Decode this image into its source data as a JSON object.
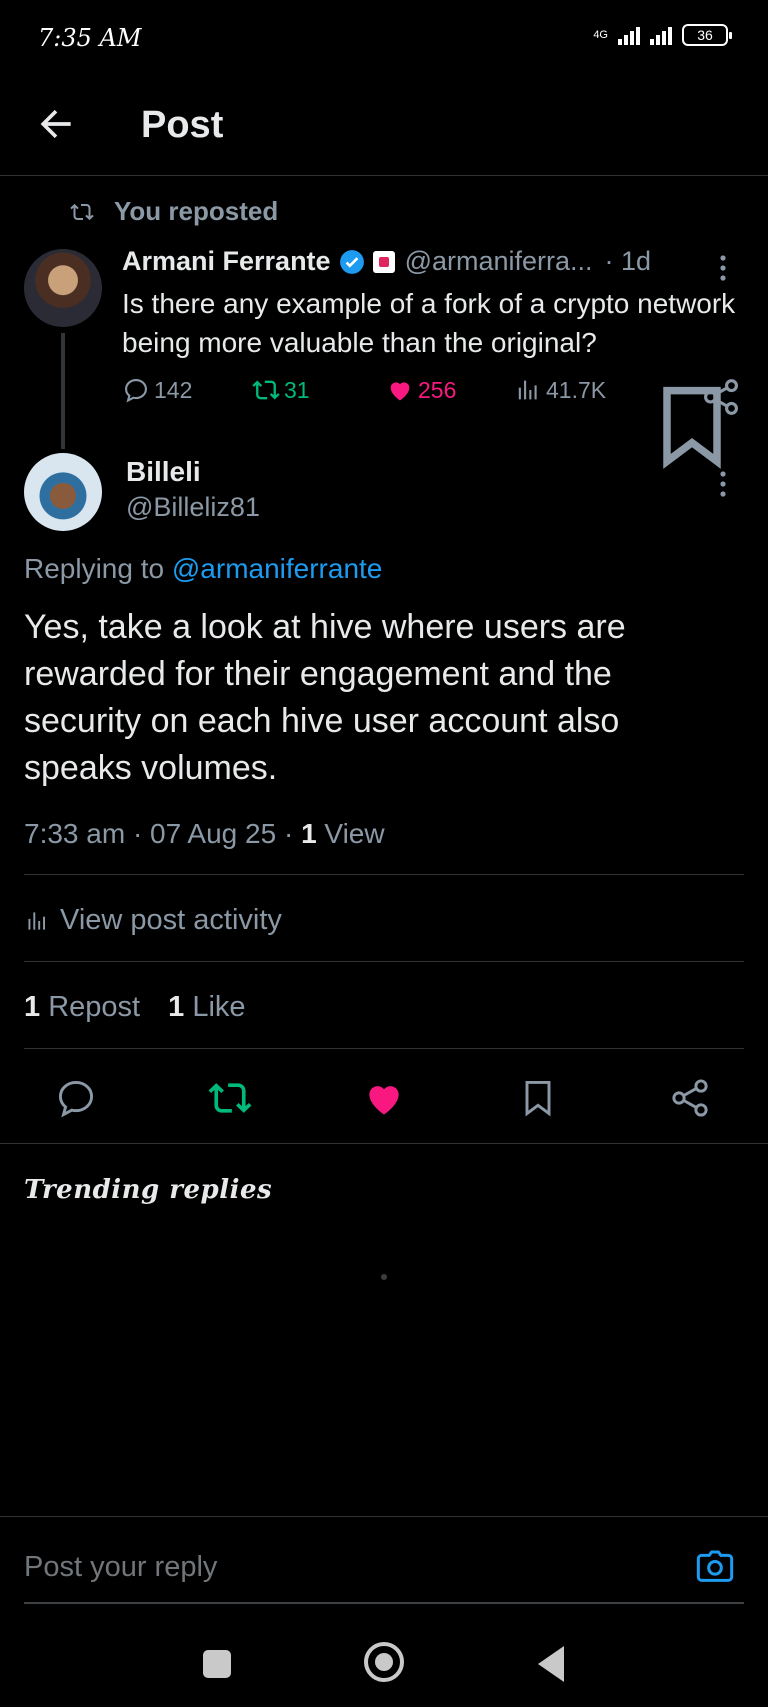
{
  "status_bar": {
    "time": "7:35 AM",
    "network": "4G",
    "battery": "36"
  },
  "header": {
    "title": "Post"
  },
  "repost": {
    "label": "You reposted"
  },
  "original_post": {
    "author": "Armani Ferrante",
    "handle": "@armaniferra...",
    "time": "· 1d",
    "text": "Is there any example of a fork of a crypto network being more valuable than the original?",
    "replies": "142",
    "reposts": "31",
    "likes": "256",
    "views": "41.7K",
    "colors": {
      "repost": "#00ba7c",
      "like": "#f91880",
      "verified": "#1d9bf0"
    }
  },
  "reply_post": {
    "author": "Billeli",
    "handle": "@Billeliz81",
    "replying_prefix": "Replying to",
    "replying_to": "@armaniferrante",
    "text": "Yes, take a look at hive where users are rewarded for their engagement and the security on each hive user account also speaks volumes.",
    "meta_time": "7:33 am · 07 Aug 25 · ",
    "meta_views_count": "1",
    "meta_views_label": " View",
    "activity_label": "View post activity",
    "repost_count": "1",
    "repost_label": " Repost",
    "like_count": "1",
    "like_label": " Like"
  },
  "trending": {
    "label": "Trending replies"
  },
  "reply_bar": {
    "placeholder": "Post your reply"
  }
}
